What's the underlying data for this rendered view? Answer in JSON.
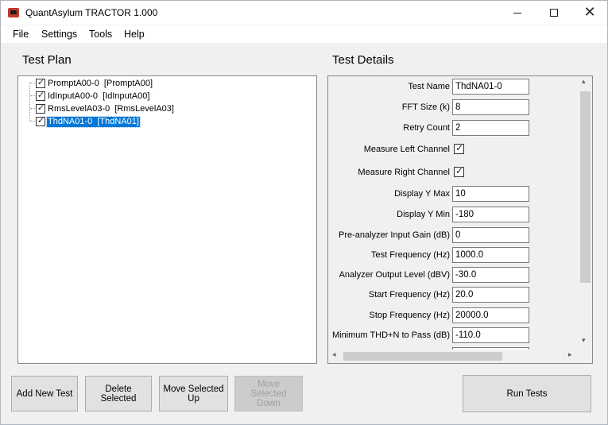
{
  "window": {
    "title": "QuantAsylum TRACTOR 1.000",
    "controls": {
      "minimize": "minimize",
      "maximize": "maximize",
      "close": "✕"
    }
  },
  "menu": [
    "File",
    "Settings",
    "Tools",
    "Help"
  ],
  "test_plan": {
    "heading": "Test Plan",
    "items": [
      {
        "label": "PromptA00-0  [PromptA00]",
        "checked": true,
        "selected": false
      },
      {
        "label": "IdInputA00-0  [IdInputA00]",
        "checked": true,
        "selected": false
      },
      {
        "label": "RmsLevelA03-0  [RmsLevelA03]",
        "checked": true,
        "selected": false
      },
      {
        "label": "ThdNA01-0  [ThdNA01]",
        "checked": true,
        "selected": true
      }
    ]
  },
  "test_details": {
    "heading": "Test Details",
    "properties": [
      {
        "label": "Test Name",
        "value": "ThdNA01-0",
        "kind": "text"
      },
      {
        "label": "FFT Size (k)",
        "value": "8",
        "kind": "text"
      },
      {
        "label": "Retry Count",
        "value": "2",
        "kind": "text"
      },
      {
        "label": "Measure Left Channel",
        "value": "checked",
        "kind": "check"
      },
      {
        "label": "Measure Right Channel",
        "value": "checked",
        "kind": "check"
      },
      {
        "label": "Display Y Max",
        "value": "10",
        "kind": "text"
      },
      {
        "label": "Display Y Min",
        "value": "-180",
        "kind": "text"
      },
      {
        "label": "Pre-analyzer Input Gain (dB)",
        "value": "0",
        "kind": "text"
      },
      {
        "label": "Test Frequency (Hz)",
        "value": "1000.0",
        "kind": "text"
      },
      {
        "label": "Analyzer Output Level (dBV)",
        "value": "-30.0",
        "kind": "text"
      },
      {
        "label": "Start Frequency (Hz)",
        "value": "20.0",
        "kind": "text"
      },
      {
        "label": "Stop Frequency (Hz)",
        "value": "20000.0",
        "kind": "text"
      },
      {
        "label": "Minimum THD+N to Pass (dB)",
        "value": "-110.0",
        "kind": "text"
      }
    ]
  },
  "buttons": {
    "add_new_test": "Add New Test",
    "delete_selected": "Delete Selected",
    "move_up": "Move Selected Up",
    "move_down": "Move Selected Down",
    "run_tests": "Run Tests"
  },
  "icons": {
    "app": "tractor-app-icon",
    "scroll_up": "▴",
    "scroll_down": "▾",
    "scroll_left": "◂",
    "scroll_right": "▸"
  }
}
